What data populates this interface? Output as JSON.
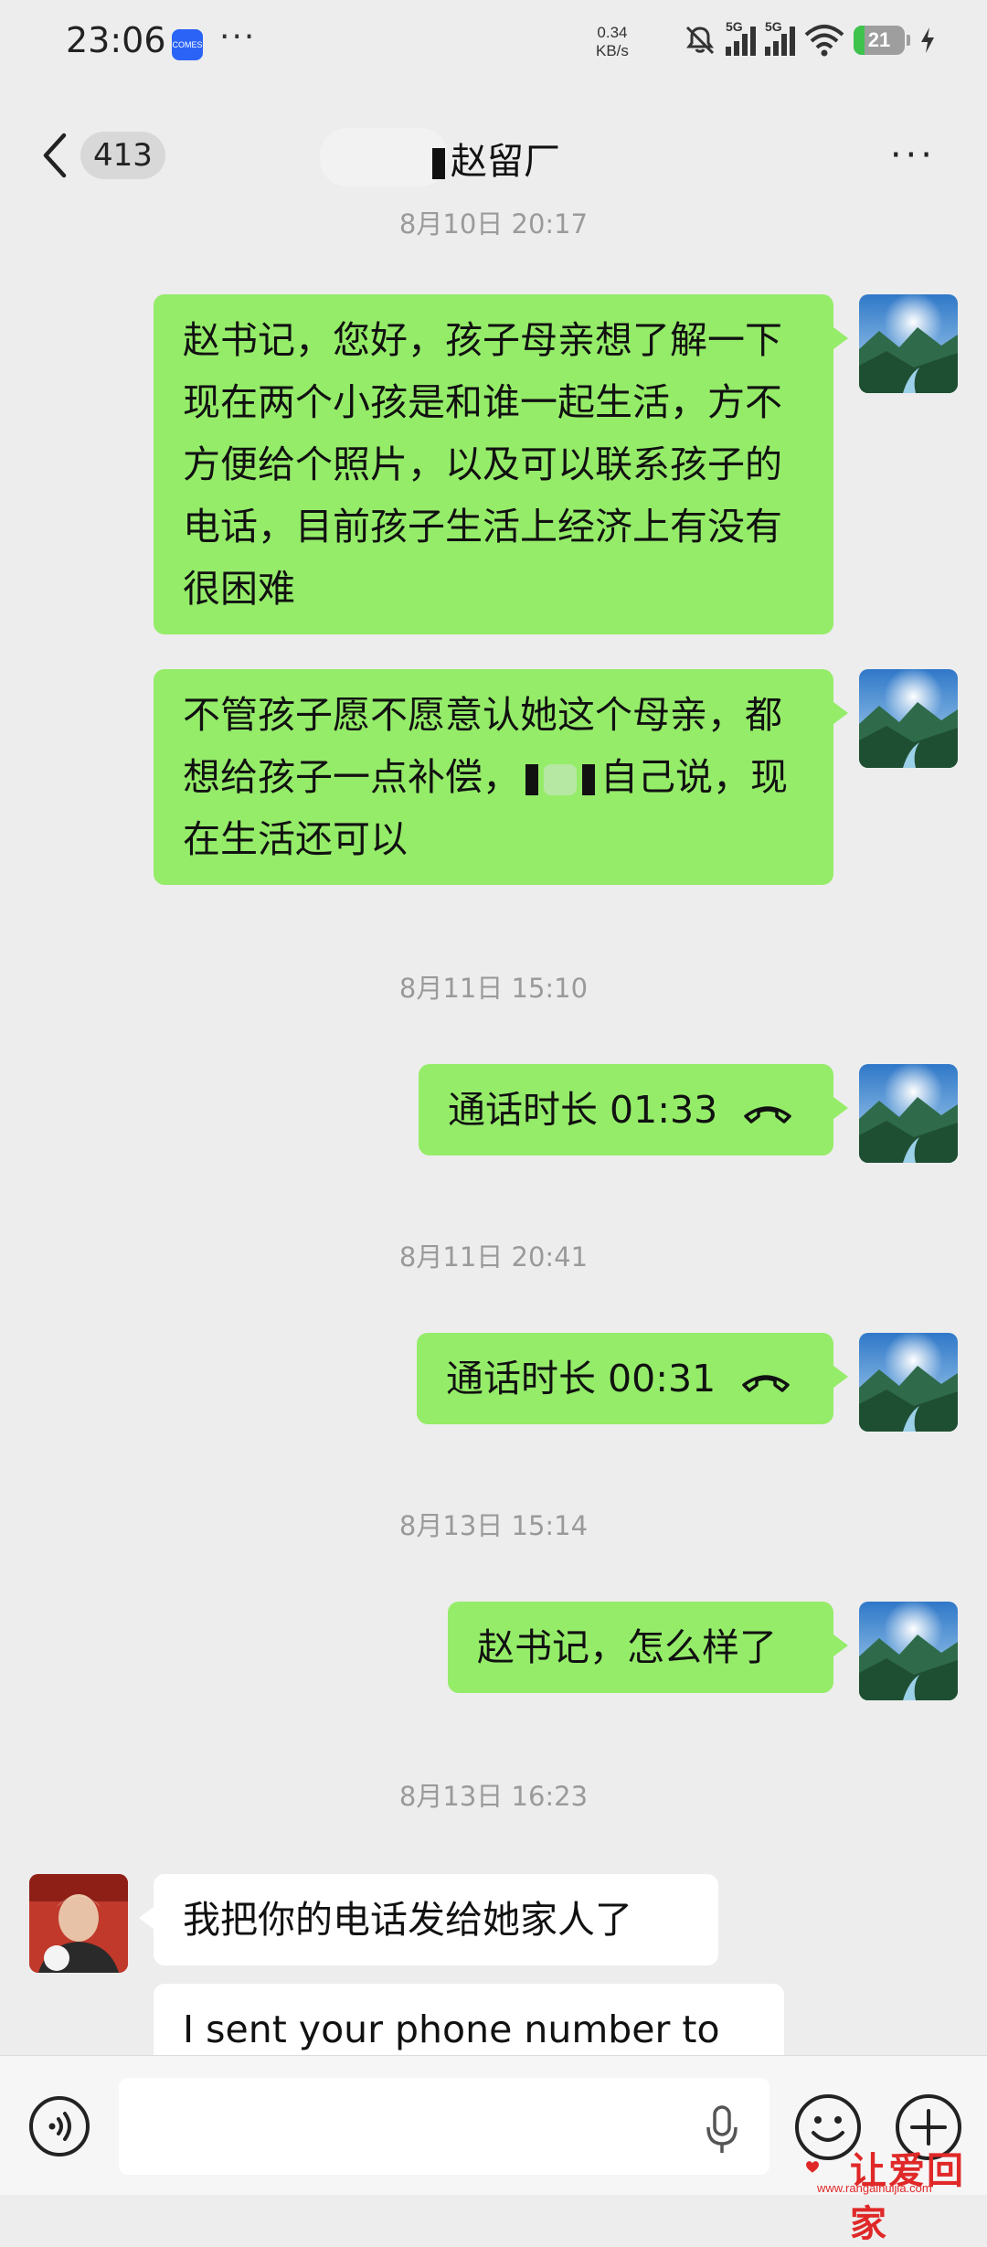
{
  "status_bar": {
    "time": "23:06",
    "app_icon_label": "COMES",
    "more": "···",
    "net_speed_value": "0.34",
    "net_speed_unit": "KB/s",
    "signal_1_label": "5G",
    "signal_2_label": "5G",
    "battery_level": "21",
    "battery_fraction": 0.21,
    "icons": [
      "mute-bell-icon",
      "signal-icon",
      "signal-icon",
      "wifi-icon",
      "battery-icon",
      "charging-icon"
    ]
  },
  "header": {
    "unread_count": "413",
    "title": "赵留厂",
    "more": "···"
  },
  "messages": [
    {
      "type": "timestamp",
      "text": "8月10日 20:17"
    },
    {
      "type": "out",
      "text": "赵书记，您好，孩子母亲想了解一下现在两个小孩是和谁一起生活，方不方便给个照片，以及可以联系孩子的电话，目前孩子生活上经济上有没有很困难"
    },
    {
      "type": "out",
      "text_before": "不管孩子愿不愿意认她这个母亲，都想给孩子一点补偿，",
      "text_after": "自己说，现在生活还可以"
    },
    {
      "type": "timestamp",
      "text": "8月11日 15:10"
    },
    {
      "type": "out-call",
      "text": "通话时长 01:33"
    },
    {
      "type": "timestamp",
      "text": "8月11日 20:41"
    },
    {
      "type": "out-call",
      "text": "通话时长 00:31"
    },
    {
      "type": "timestamp",
      "text": "8月13日 15:14"
    },
    {
      "type": "out",
      "text": "赵书记，怎么样了"
    },
    {
      "type": "timestamp",
      "text": "8月13日 16:23"
    },
    {
      "type": "in",
      "text": "我把你的电话发给她家人了"
    },
    {
      "type": "in",
      "text": "I sent your phone number to"
    }
  ],
  "input_bar": {
    "placeholder": "",
    "icons": [
      "voice-icon",
      "mic-icon",
      "emoji-icon",
      "plus-icon"
    ]
  },
  "watermark": {
    "text": "让爱回家",
    "url": "www.rangaihuijia.com"
  },
  "colors": {
    "background": "#ededed",
    "bubble_out": "#95ec69",
    "bubble_in": "#ffffff",
    "battery_fill": "#3ec34d",
    "watermark": "#e02828"
  }
}
